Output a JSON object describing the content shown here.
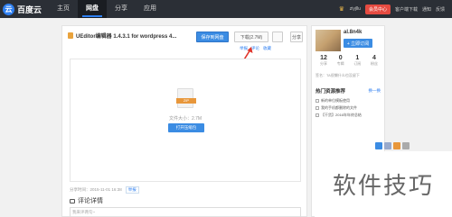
{
  "header": {
    "logo_glyph": "云",
    "logo_text": "百度云",
    "nav": [
      "主页",
      "网盘",
      "分享",
      "应用"
    ],
    "active_nav": "网盘",
    "username": "ziyjllu",
    "upgrade_label": "会员中心",
    "links": [
      "客户端下载",
      "通知",
      "反馈"
    ]
  },
  "file": {
    "title": "UEditor编辑器 1.4.3.1 for wordpress 4...",
    "save_label": "保存到网盘",
    "download_label": "下载(2.7M)",
    "share_label": "分享",
    "actions": [
      "举报",
      "评论",
      "收藏"
    ],
    "type_tag": "ZIP",
    "size_text": "文件大小：2.7M",
    "open_label": "打开压缩包",
    "share_time": "分享时间：2015-11-01 16:38",
    "report_label": "举报"
  },
  "comments": {
    "title": "评论详情",
    "placeholder": "我来评两句~"
  },
  "profile": {
    "name": "al.8n4k",
    "subscribe_label": "+ 立即订阅",
    "stats": [
      {
        "num": "12",
        "label": "分享"
      },
      {
        "num": "0",
        "label": "专辑"
      },
      {
        "num": "1",
        "label": "订阅"
      },
      {
        "num": "4",
        "label": "粉丝"
      }
    ],
    "signature": "签名：TA很懒什么也没留下"
  },
  "hot": {
    "title": "热门资源推荐",
    "refresh": "换一换",
    "items": [
      "新的单位模板使用",
      "我的手机都删除的文件",
      "【干货】2016年年终总结"
    ]
  },
  "watermark": "软件技巧",
  "colors": {
    "accent": "#3b8ce3",
    "topbar": "#2b2f36",
    "upgrade": "#e64b41",
    "arrow": "#e0342a"
  }
}
